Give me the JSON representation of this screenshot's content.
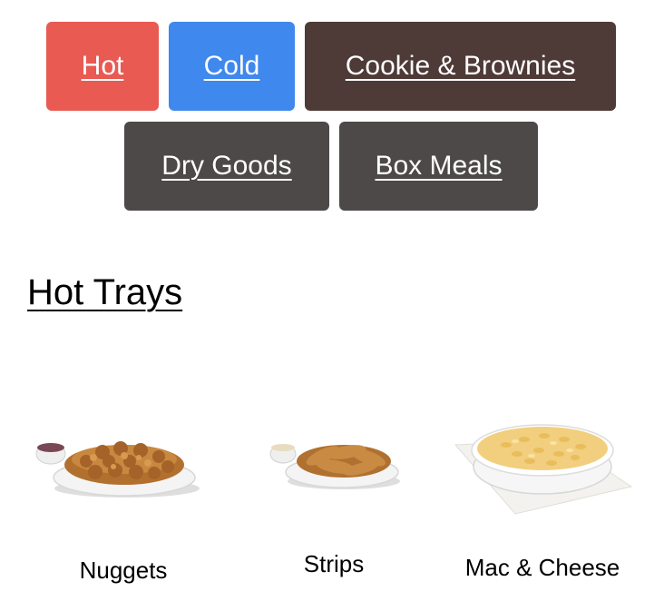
{
  "categories": [
    {
      "id": "hot",
      "label": "Hot",
      "color": "#e85a52"
    },
    {
      "id": "cold",
      "label": "Cold",
      "color": "#3f88ee"
    },
    {
      "id": "cookie",
      "label": "Cookie & Brownies",
      "color": "#4e3a37"
    },
    {
      "id": "dry",
      "label": "Dry Goods",
      "color": "#4c4948"
    },
    {
      "id": "box",
      "label": "Box Meals",
      "color": "#4c4948"
    }
  ],
  "section": {
    "title": "Hot Trays"
  },
  "items": [
    {
      "label": "Nuggets",
      "icon": "nuggets-tray-image"
    },
    {
      "label": "Strips",
      "icon": "strips-tray-image"
    },
    {
      "label": "Mac & Cheese",
      "icon": "mac-and-cheese-tray-image"
    }
  ]
}
